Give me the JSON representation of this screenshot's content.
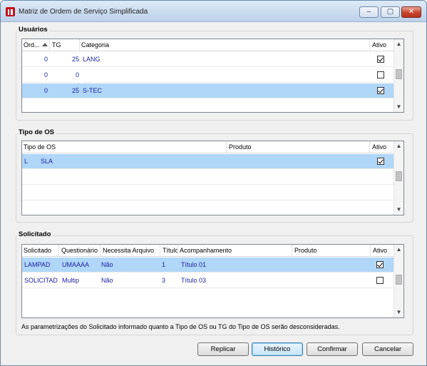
{
  "window": {
    "title": "Matriz de Ordem de Serviço Simplificada",
    "minimize": "‒",
    "restore": "▢",
    "close": "✕"
  },
  "usuarios": {
    "group_title": "Usuários",
    "headers": {
      "ordem": "Ord...",
      "tg": "TG",
      "categoria": "Categoria",
      "ativo": "Ativo"
    },
    "rows": [
      {
        "ordem": "0",
        "tg": "25",
        "categoria": "LANG",
        "ativo": true,
        "selected": false
      },
      {
        "ordem": "0",
        "tg": "0",
        "categoria": "",
        "ativo": false,
        "selected": false
      },
      {
        "ordem": "0",
        "tg": "25",
        "categoria": "S-TEC",
        "ativo": true,
        "selected": true
      }
    ]
  },
  "tipo_os": {
    "group_title": "Tipo de OS",
    "headers": {
      "tipo": "Tipo de OS",
      "produto": "Produto",
      "ativo": "Ativo"
    },
    "rows": [
      {
        "codigo": "L",
        "tipo": "SLA",
        "produto": "",
        "ativo": true,
        "selected": true
      }
    ]
  },
  "solicitado": {
    "group_title": "Solicitado",
    "headers": {
      "solicitado": "Solicitado",
      "questionario": "Questionário",
      "necessita": "Necessita Arquivo",
      "titulo": "Título",
      "acompanhamento": "Acompanhamento",
      "produto": "Produto",
      "ativo": "Ativo"
    },
    "rows": [
      {
        "solicitado": "LAMPAD",
        "questionario": "UMAAAA",
        "necessita": "Não",
        "titulo": "1",
        "acompanhamento": "Título 01",
        "produto": "",
        "ativo": true,
        "selected": true
      },
      {
        "solicitado": "SOLICITAD",
        "questionario": "Multip",
        "necessita": "Não",
        "titulo": "3",
        "acompanhamento": "Título 03",
        "produto": "",
        "ativo": false,
        "selected": false
      }
    ]
  },
  "note": "As parametrizações do Solicitado informado quanto a Tipo de OS ou TG do Tipo de OS serão desconsideradas.",
  "buttons": {
    "replicar": "Replicar",
    "historico": "Histórico",
    "confirmar": "Confirmar",
    "cancelar": "Cancelar"
  },
  "scroll": {
    "up": "▲",
    "down": "▼"
  }
}
